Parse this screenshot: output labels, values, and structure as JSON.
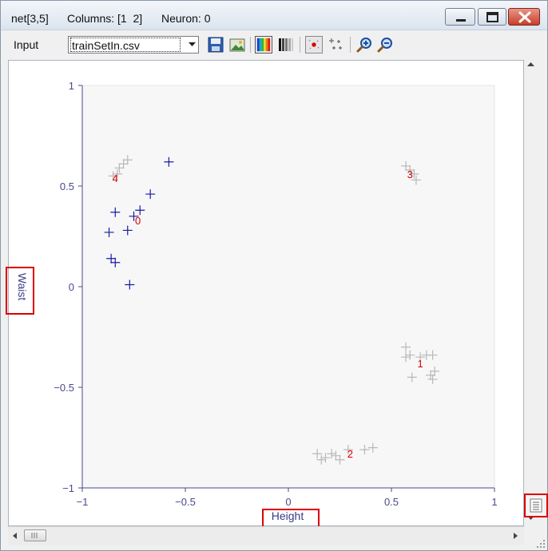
{
  "window": {
    "title_net": "net[3,5]",
    "title_columns": "Columns: [1  2]",
    "title_neuron": "Neuron: 0"
  },
  "toolbar": {
    "input_label": "Input",
    "file_select_value": "trainSetIn.csv",
    "icons": [
      "save-icon",
      "export-image-icon",
      "color-map-icon",
      "grayscale-map-icon",
      "show-neurons-icon",
      "show-data-icon",
      "zoom-in-icon",
      "zoom-out-icon"
    ]
  },
  "chart_data": {
    "type": "scatter",
    "xlabel": "Height",
    "ylabel": "Waist",
    "xlim": [
      -1,
      1
    ],
    "ylim": [
      -1,
      1
    ],
    "xticks": [
      {
        "v": -1,
        "label": "−1"
      },
      {
        "v": -0.5,
        "label": "−0.5"
      },
      {
        "v": 0,
        "label": "0"
      },
      {
        "v": 0.5,
        "label": "0.5"
      },
      {
        "v": 1,
        "label": "1"
      }
    ],
    "yticks": [
      {
        "v": 1,
        "label": "1"
      },
      {
        "v": 0.5,
        "label": "0.5"
      },
      {
        "v": 0,
        "label": "0"
      },
      {
        "v": -0.5,
        "label": "−0.5"
      },
      {
        "v": -1,
        "label": "−1"
      }
    ],
    "grid": false,
    "colors": {
      "selected": "#1a1aa8",
      "other": "#b8b8b8",
      "neuron_label": "#dd0000",
      "axis": "#4a4a8a"
    },
    "series": [
      {
        "color": "#1a1aa8",
        "points": [
          [
            -0.58,
            0.62
          ],
          [
            -0.67,
            0.46
          ],
          [
            -0.72,
            0.38
          ],
          [
            -0.75,
            0.35
          ],
          [
            -0.84,
            0.37
          ],
          [
            -0.78,
            0.28
          ],
          [
            -0.87,
            0.27
          ],
          [
            -0.86,
            0.14
          ],
          [
            -0.84,
            0.12
          ],
          [
            -0.77,
            0.01
          ]
        ]
      },
      {
        "color": "#b8b8b8",
        "points": [
          [
            -0.78,
            0.63
          ],
          [
            -0.8,
            0.61
          ],
          [
            -0.82,
            0.59
          ],
          [
            -0.83,
            0.56
          ],
          [
            -0.85,
            0.55
          ],
          [
            0.57,
            0.6
          ],
          [
            0.59,
            0.58
          ],
          [
            0.61,
            0.56
          ],
          [
            0.62,
            0.53
          ],
          [
            0.57,
            -0.3
          ],
          [
            0.57,
            -0.35
          ],
          [
            0.59,
            -0.34
          ],
          [
            0.6,
            -0.45
          ],
          [
            0.64,
            -0.35
          ],
          [
            0.67,
            -0.34
          ],
          [
            0.7,
            -0.34
          ],
          [
            0.7,
            -0.46
          ],
          [
            0.71,
            -0.42
          ],
          [
            0.69,
            -0.44
          ],
          [
            0.14,
            -0.83
          ],
          [
            0.16,
            -0.86
          ],
          [
            0.18,
            -0.85
          ],
          [
            0.21,
            -0.83
          ],
          [
            0.23,
            -0.84
          ],
          [
            0.25,
            -0.86
          ],
          [
            0.29,
            -0.81
          ],
          [
            0.37,
            -0.81
          ],
          [
            0.41,
            -0.8
          ]
        ]
      }
    ],
    "annotations": [
      {
        "label": "0",
        "x": -0.73,
        "y": 0.33
      },
      {
        "label": "1",
        "x": 0.64,
        "y": -0.38
      },
      {
        "label": "2",
        "x": 0.3,
        "y": -0.83
      },
      {
        "label": "3",
        "x": 0.59,
        "y": 0.56
      },
      {
        "label": "4",
        "x": -0.84,
        "y": 0.54
      }
    ]
  }
}
